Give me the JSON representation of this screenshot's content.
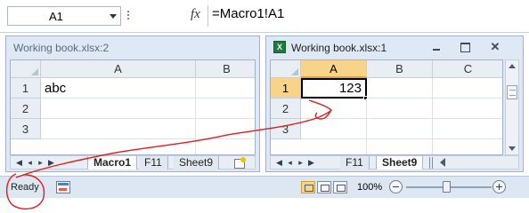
{
  "formula_bar": {
    "name_box_value": "A1",
    "fx_symbol": "fx",
    "formula": "=Macro1!A1"
  },
  "left_window": {
    "title": "Working book.xlsx:2",
    "columns": [
      "A",
      "B"
    ],
    "rows": [
      "1",
      "2",
      "3"
    ],
    "cells": {
      "A1": "abc"
    },
    "tabs": [
      "Macro1",
      "F11",
      "Sheet9"
    ],
    "active_tab": "Macro1"
  },
  "right_window": {
    "title": "Working book.xlsx:1",
    "columns": [
      "A",
      "B",
      "C"
    ],
    "rows": [
      "1",
      "2",
      "3"
    ],
    "cells": {
      "A1": "123"
    },
    "active_cell": "A1",
    "tabs": [
      "F11",
      "Sheet9"
    ],
    "active_tab": "Sheet9"
  },
  "status_bar": {
    "status": "Ready",
    "zoom": "100%",
    "zoom_percent": 100,
    "view_mode": "normal"
  },
  "icons": [
    "excel-icon",
    "macro-recording-icon",
    "insert-sheet-icon",
    "minimize-icon",
    "maximize-icon",
    "close-icon"
  ],
  "annotation_color": "#e11b1b"
}
